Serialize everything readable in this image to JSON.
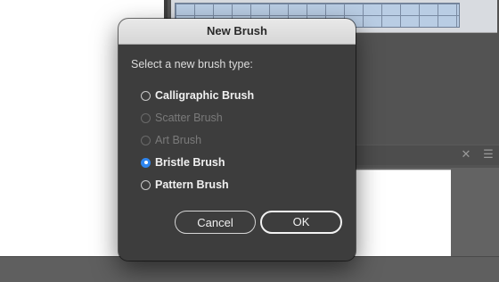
{
  "dialog": {
    "title": "New Brush",
    "prompt": "Select a new brush type:",
    "options": [
      {
        "label": "Calligraphic Brush",
        "enabled": true,
        "selected": false
      },
      {
        "label": "Scatter Brush",
        "enabled": false,
        "selected": false
      },
      {
        "label": "Art Brush",
        "enabled": false,
        "selected": false
      },
      {
        "label": "Bristle Brush",
        "enabled": true,
        "selected": true
      },
      {
        "label": "Pattern Brush",
        "enabled": true,
        "selected": false
      }
    ],
    "buttons": {
      "cancel_label": "Cancel",
      "ok_label": "OK"
    }
  },
  "panel": {
    "footer_icons": [
      "delete-brush-icon",
      "brush-options-icon"
    ]
  },
  "colors": {
    "accent": "#2f86f0",
    "dialog_background": "#3d3d3d",
    "titlebar": "#dcdcdc",
    "app_background": "#636363"
  }
}
